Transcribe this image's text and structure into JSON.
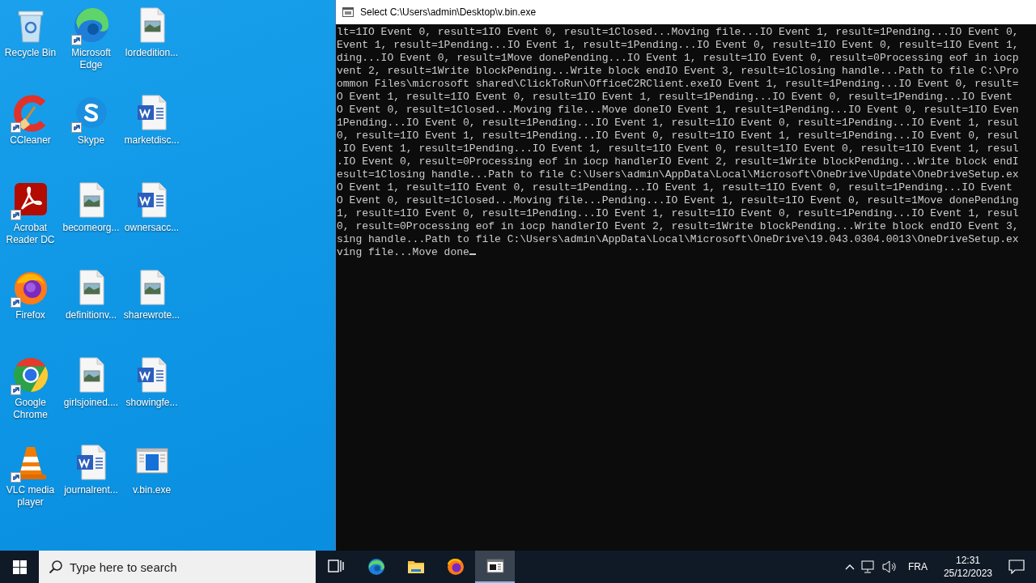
{
  "desktop_icons": [
    {
      "label": "Recycle Bin",
      "kind": "recycle",
      "shortcut": false
    },
    {
      "label": "CCleaner",
      "kind": "ccleaner",
      "shortcut": true
    },
    {
      "label": "Acrobat Reader DC",
      "kind": "acrobat",
      "shortcut": true
    },
    {
      "label": "Firefox",
      "kind": "firefox",
      "shortcut": true
    },
    {
      "label": "Google Chrome",
      "kind": "chrome",
      "shortcut": true
    },
    {
      "label": "VLC media player",
      "kind": "vlc",
      "shortcut": true
    },
    {
      "label": "Microsoft Edge",
      "kind": "edge",
      "shortcut": true
    },
    {
      "label": "Skype",
      "kind": "skype",
      "shortcut": true
    },
    {
      "label": "becomeorg...",
      "kind": "image",
      "shortcut": false
    },
    {
      "label": "definitionv...",
      "kind": "image",
      "shortcut": false
    },
    {
      "label": "girlsjoined....",
      "kind": "image",
      "shortcut": false
    },
    {
      "label": "journalrent...",
      "kind": "word",
      "shortcut": false
    },
    {
      "label": "lordedition...",
      "kind": "image",
      "shortcut": false
    },
    {
      "label": "marketdisc...",
      "kind": "word",
      "shortcut": false
    },
    {
      "label": "ownersacc...",
      "kind": "word",
      "shortcut": false
    },
    {
      "label": "sharewrote...",
      "kind": "image",
      "shortcut": false
    },
    {
      "label": "showingfe...",
      "kind": "word",
      "shortcut": false
    },
    {
      "label": "v.bin.exe",
      "kind": "exe",
      "shortcut": false
    }
  ],
  "window": {
    "title": "Select C:\\Users\\admin\\Desktop\\v.bin.exe",
    "lines": [
      "lt=1IO Event 0, result=1IO Event 0, result=1Closed...Moving file...IO Event 1, result=1Pending...IO Event 0,",
      "Event 1, result=1Pending...IO Event 1, result=1Pending...IO Event 0, result=1IO Event 0, result=1IO Event 1,",
      "ding...IO Event 0, result=1Move donePending...IO Event 1, result=1IO Event 0, result=0Processing eof in iocp",
      "vent 2, result=1Write blockPending...Write block endIO Event 3, result=1Closing handle...Path to file C:\\Pro",
      "ommon Files\\microsoft shared\\ClickToRun\\OfficeC2RClient.exeIO Event 1, result=1Pending...IO Event 0, result=",
      "O Event 1, result=1IO Event 0, result=1IO Event 1, result=1Pending...IO Event 0, result=1Pending...IO Event",
      "O Event 0, result=1Closed...Moving file...Move doneIO Event 1, result=1Pending...IO Event 0, result=1IO Even",
      "1Pending...IO Event 0, result=1Pending...IO Event 1, result=1IO Event 0, result=1Pending...IO Event 1, resul",
      "0, result=1IO Event 1, result=1Pending...IO Event 0, result=1IO Event 1, result=1Pending...IO Event 0, resul",
      ".IO Event 1, result=1Pending...IO Event 1, result=1IO Event 0, result=1IO Event 0, result=1IO Event 1, resul",
      ".IO Event 0, result=0Processing eof in iocp handlerIO Event 2, result=1Write blockPending...Write block endI",
      "esult=1Closing handle...Path to file C:\\Users\\admin\\AppData\\Local\\Microsoft\\OneDrive\\Update\\OneDriveSetup.ex",
      "O Event 1, result=1IO Event 0, result=1Pending...IO Event 1, result=1IO Event 0, result=1Pending...IO Event",
      "O Event 0, result=1Closed...Moving file...Pending...IO Event 1, result=1IO Event 0, result=1Move donePending",
      "1, result=1IO Event 0, result=1Pending...IO Event 1, result=1IO Event 0, result=1Pending...IO Event 1, resul",
      "0, result=0Processing eof in iocp handlerIO Event 2, result=1Write blockPending...Write block endIO Event 3,",
      "sing handle...Path to file C:\\Users\\admin\\AppData\\Local\\Microsoft\\OneDrive\\19.043.0304.0013\\OneDriveSetup.ex",
      "ving file...Move done"
    ]
  },
  "taskbar": {
    "search_placeholder": "Type here to search",
    "apps": [
      {
        "kind": "taskview",
        "selected": false
      },
      {
        "kind": "edge",
        "selected": false
      },
      {
        "kind": "explorer",
        "selected": false
      },
      {
        "kind": "firefox",
        "selected": false
      },
      {
        "kind": "console",
        "selected": true
      }
    ],
    "language": "FRA",
    "time": "12:31",
    "date": "25/12/2023"
  }
}
